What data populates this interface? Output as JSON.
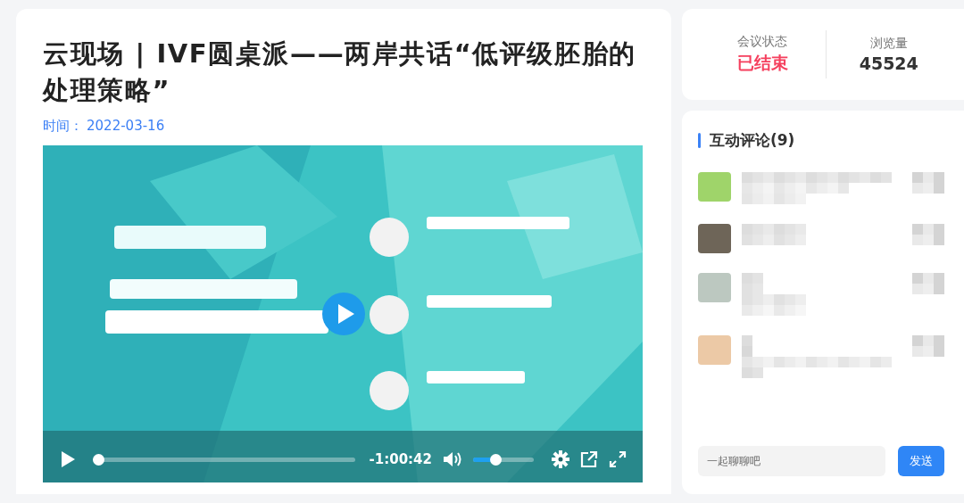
{
  "article": {
    "title": "云现场 | IVF圆桌派——两岸共话“低评级胚胎的处理策略”",
    "date_label": "时间：",
    "date": "2022-03-16"
  },
  "video": {
    "kind": "picture",
    "playing": false,
    "progress": {
      "level": 0.0
    },
    "time": "-1:00:42",
    "volume": {
      "level": 0.38
    }
  },
  "stats": [
    {
      "label": "会议状态",
      "value": "已结束",
      "kind": "status"
    },
    {
      "label": "浏览量",
      "value": "45524",
      "kind": "count"
    }
  ],
  "comments_panel": {
    "title": "互动评论(9)",
    "comments": [
      {
        "kind": "blurred",
        "color": "#9fd46a"
      },
      {
        "kind": "blurred",
        "color": "#6e6558"
      },
      {
        "kind": "blurred",
        "color": "#bcc8c0"
      },
      {
        "kind": "blurred",
        "color": "#ecc9a6"
      }
    ],
    "input": {
      "placeholder": "一起聊聊吧"
    },
    "send_button": "发送"
  }
}
